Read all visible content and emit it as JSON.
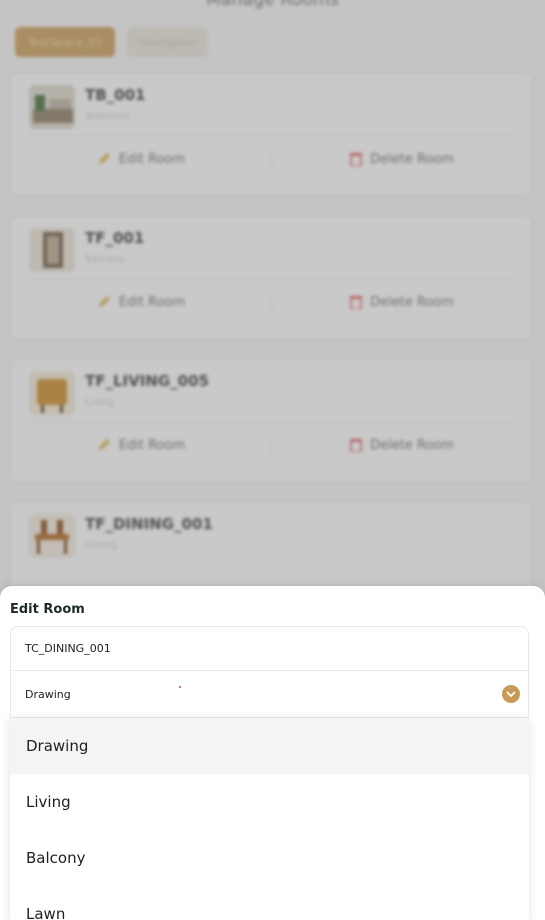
{
  "header": {
    "title": "Manage Rooms"
  },
  "spaces": [
    "TestSpace_02",
    "UserSpace"
  ],
  "rooms": [
    {
      "name": "TB_001",
      "type": "Bedroom",
      "edit_label": "Edit Room",
      "delete_label": "Delete Room"
    },
    {
      "name": "TF_001",
      "type": "Balcony",
      "edit_label": "Edit Room",
      "delete_label": "Delete Room"
    },
    {
      "name": "TF_LIVING_005",
      "type": "Living",
      "edit_label": "Edit Room",
      "delete_label": "Delete Room"
    },
    {
      "name": "TF_DINING_001",
      "type": "Dining"
    }
  ],
  "sheet": {
    "title": "Edit Room",
    "name_value": "TC_DINING_001",
    "selected_type": "Drawing"
  },
  "dropdown": {
    "options": [
      "Drawing",
      "Living",
      "Balcony",
      "Lawn"
    ]
  },
  "colors": {
    "accent": "#c89a55",
    "delete": "#e05555",
    "edit": "#d9b44a"
  }
}
